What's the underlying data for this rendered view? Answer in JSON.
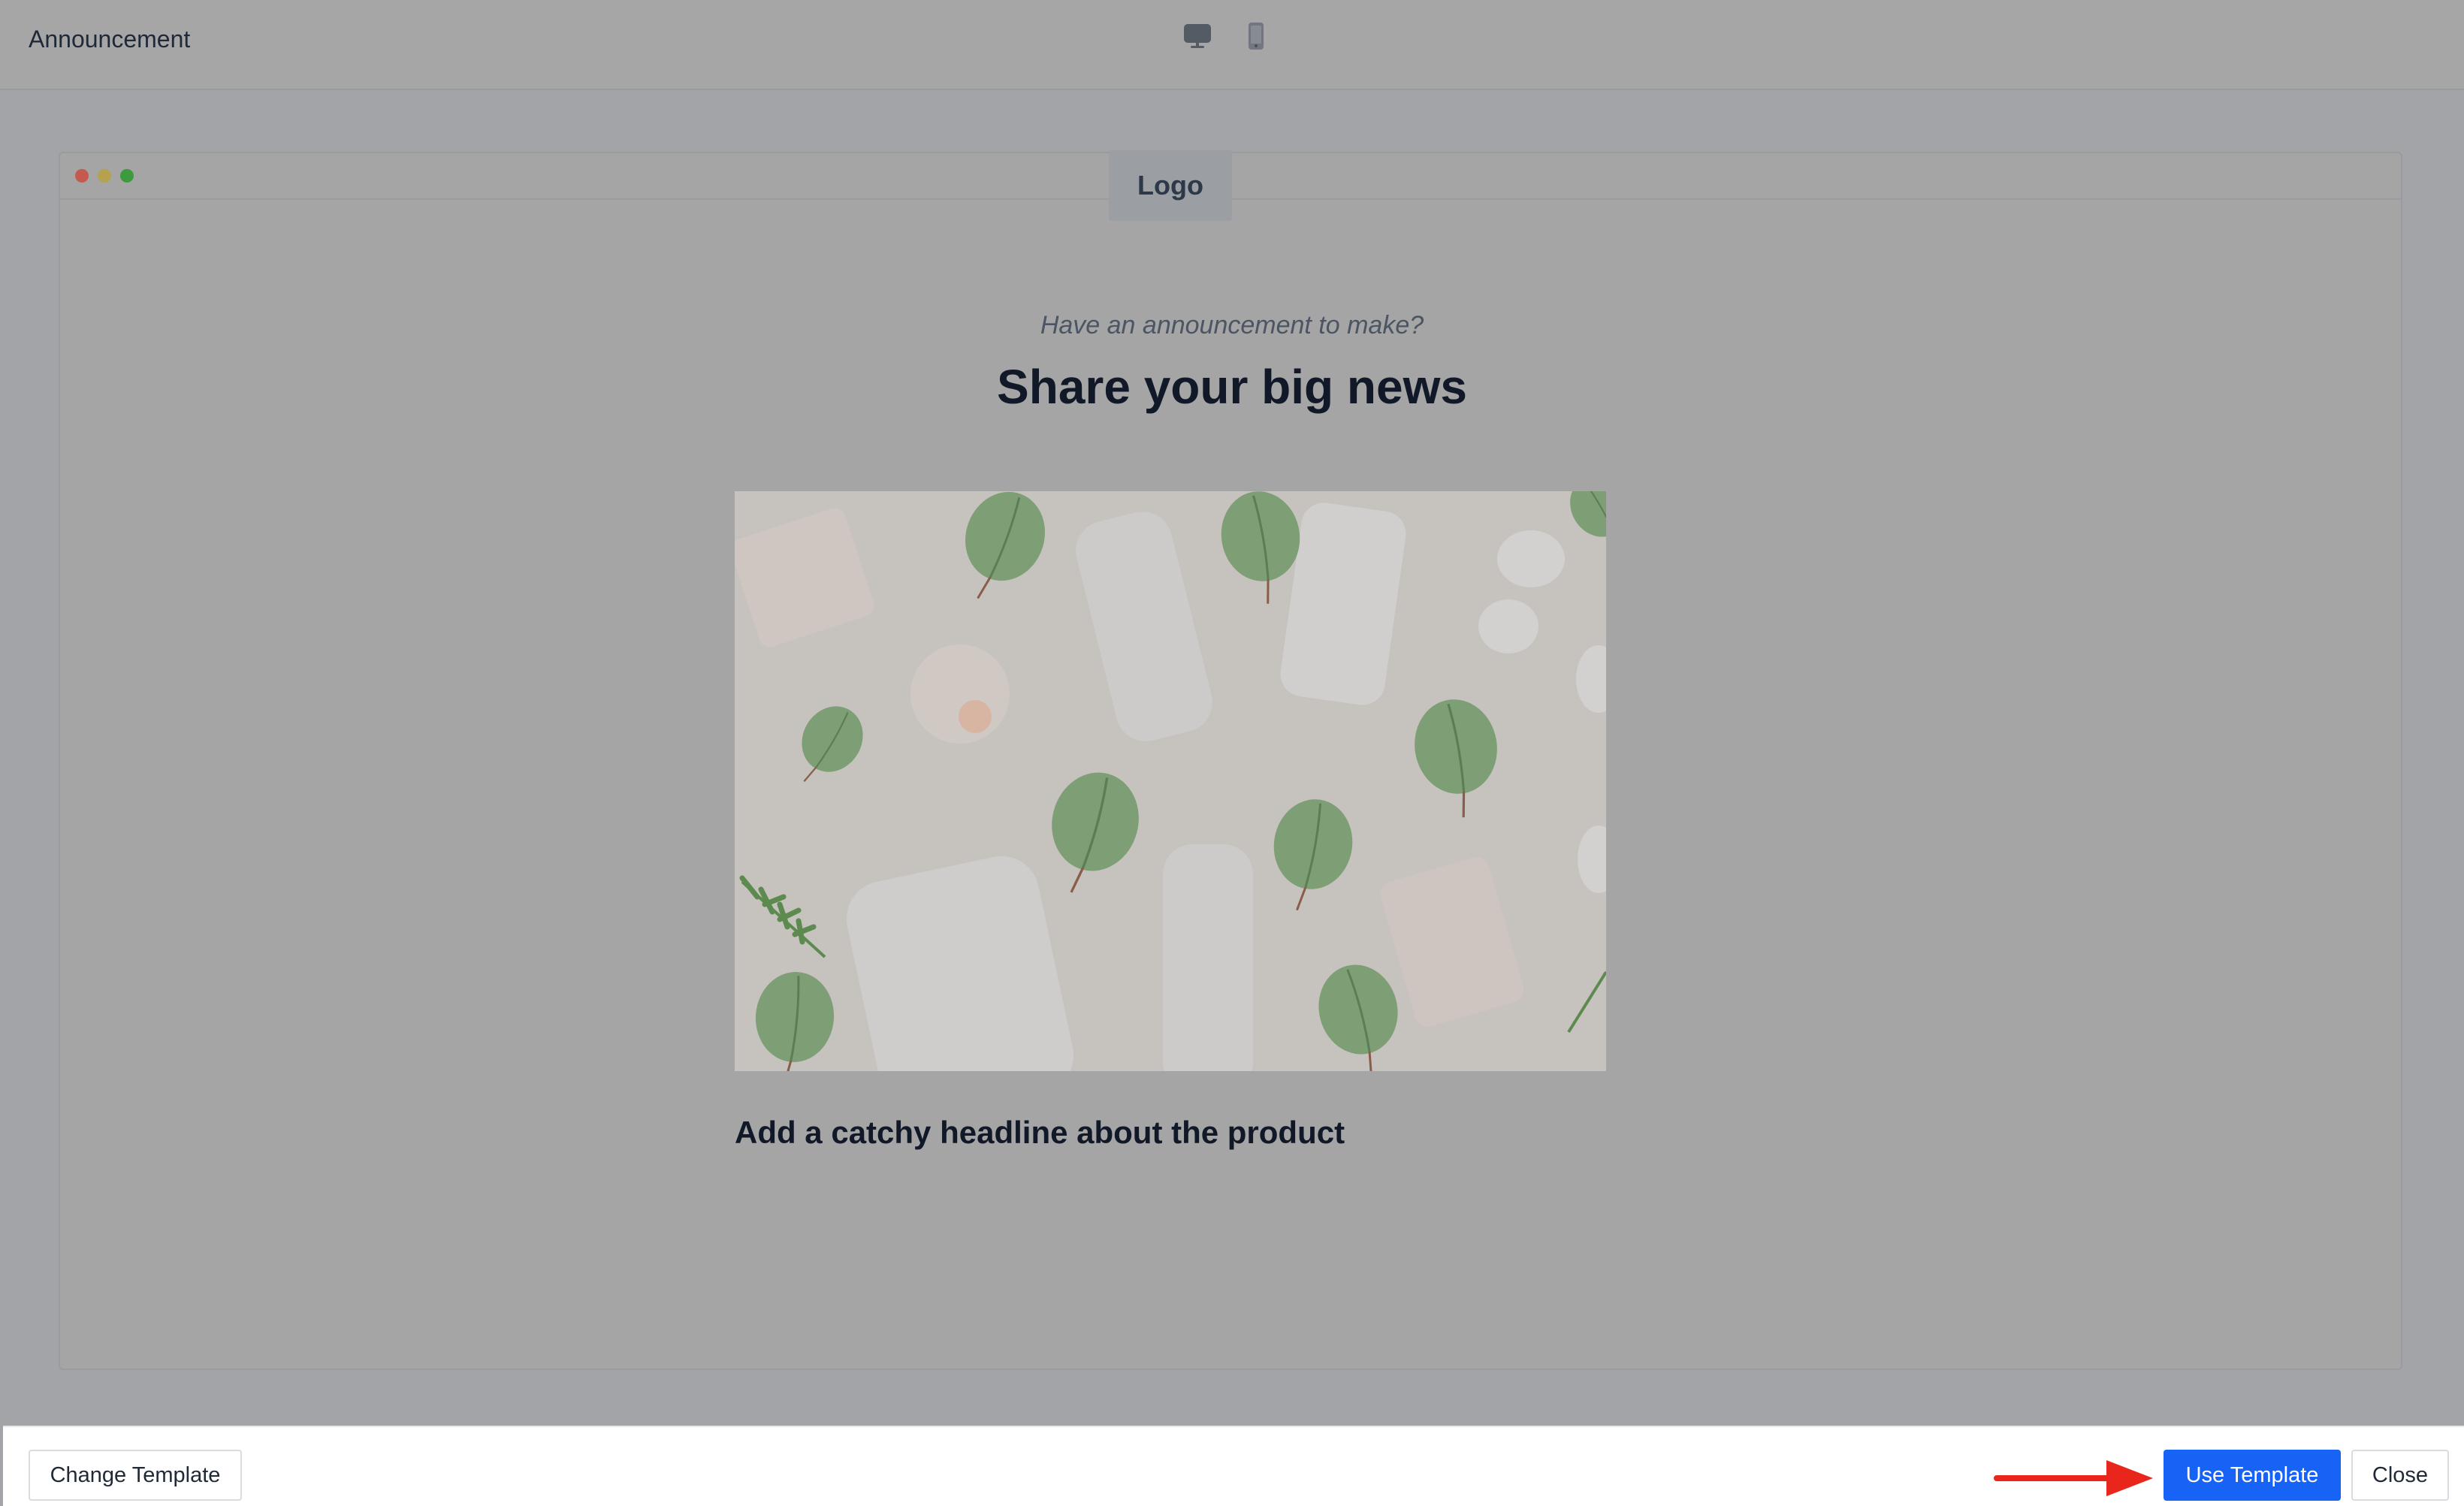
{
  "header": {
    "title": "Announcement",
    "view_options": [
      {
        "name": "desktop",
        "icon": "desktop-icon"
      },
      {
        "name": "mobile",
        "icon": "mobile-icon"
      }
    ]
  },
  "preview": {
    "logo_text": "Logo",
    "subtitle": "Have an announcement to make?",
    "headline": "Share your big news",
    "hero_image": "product bottles with eucalyptus leaves",
    "product_headline": "Add a catchy headline about the product"
  },
  "footer": {
    "change_template_label": "Change Template",
    "use_template_label": "Use Template",
    "close_label": "Close"
  },
  "colors": {
    "primary": "#1763f5",
    "annotation_arrow": "#e8261c",
    "overlay": "#a3a4a7"
  }
}
